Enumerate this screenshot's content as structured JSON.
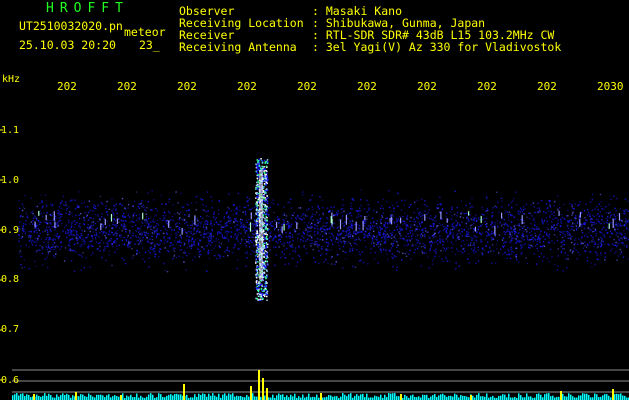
{
  "header": {
    "app_title": "HROFFT",
    "file_name": "UT2510032020.pn",
    "event_type": "meteor",
    "datetime": "25.10.03 20:20",
    "counter": "23_"
  },
  "station_info": [
    {
      "label": "Observer",
      "value": ": Masaki Kano"
    },
    {
      "label": "Receiving Location",
      "value": ": Shibukawa, Gunma, Japan"
    },
    {
      "label": "Receiver",
      "value": ": RTL-SDR SDR# 43dB L15 103.2MHz CW"
    },
    {
      "label": "Receiving Antenna",
      "value": ": 3el Yagi(V) Az 330 for Vladivostok"
    }
  ],
  "y_axis": {
    "unit": "kHz",
    "ticks": [
      "1.1",
      "1.0",
      "0.9",
      "0.8",
      "0.7",
      "0.6"
    ]
  },
  "x_axis": {
    "ticks": [
      "202",
      "202",
      "202",
      "202",
      "202",
      "202",
      "202",
      "202",
      "202",
      "2030"
    ]
  },
  "colors": {
    "background": "#000000",
    "header_text": "#ffff00",
    "app_title": "#22ff22",
    "signal_low": "#1a1aff",
    "signal_high": "#ffffff",
    "meteor_echo": "#33ff99",
    "level_bars": "#ffff00",
    "noise_floor": "#00ffff"
  }
}
